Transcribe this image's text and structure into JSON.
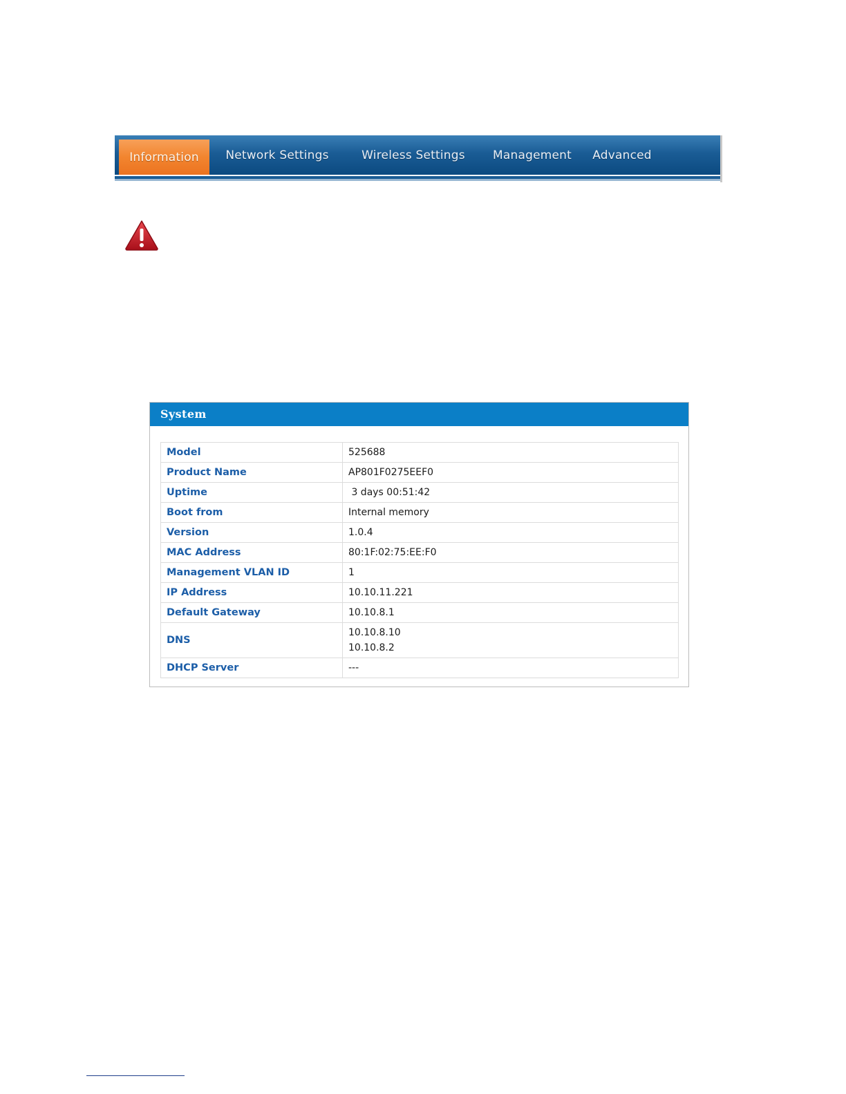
{
  "nav": {
    "tabs": [
      {
        "label": "Information",
        "active": true
      },
      {
        "label": "Network Settings",
        "active": false
      },
      {
        "label": "Wireless Settings",
        "active": false
      },
      {
        "label": "Management",
        "active": false
      },
      {
        "label": "Advanced",
        "active": false
      }
    ]
  },
  "colors": {
    "nav_blue": "#1a5c95",
    "nav_active_orange": "#f2852f",
    "panel_header_blue": "#0b7fc7",
    "label_blue": "#1c5ea8",
    "warning_red": "#c8102e"
  },
  "icons": {
    "warning": "warning-triangle-icon"
  },
  "system": {
    "title": "System",
    "rows": [
      {
        "label": "Model",
        "value": "525688"
      },
      {
        "label": "Product Name",
        "value": "AP801F0275EEF0"
      },
      {
        "label": "Uptime",
        "value": " 3 days 00:51:42"
      },
      {
        "label": "Boot from",
        "value": "Internal memory"
      },
      {
        "label": "Version",
        "value": "1.0.4"
      },
      {
        "label": "MAC Address",
        "value": "80:1F:02:75:EE:F0"
      },
      {
        "label": "Management VLAN ID",
        "value": "1"
      },
      {
        "label": "IP Address",
        "value": "10.10.11.221"
      },
      {
        "label": "Default Gateway",
        "value": "10.10.8.1"
      },
      {
        "label": "DNS",
        "values": [
          "10.10.8.10",
          "10.10.8.2"
        ]
      },
      {
        "label": "DHCP Server",
        "value": "---"
      }
    ]
  }
}
